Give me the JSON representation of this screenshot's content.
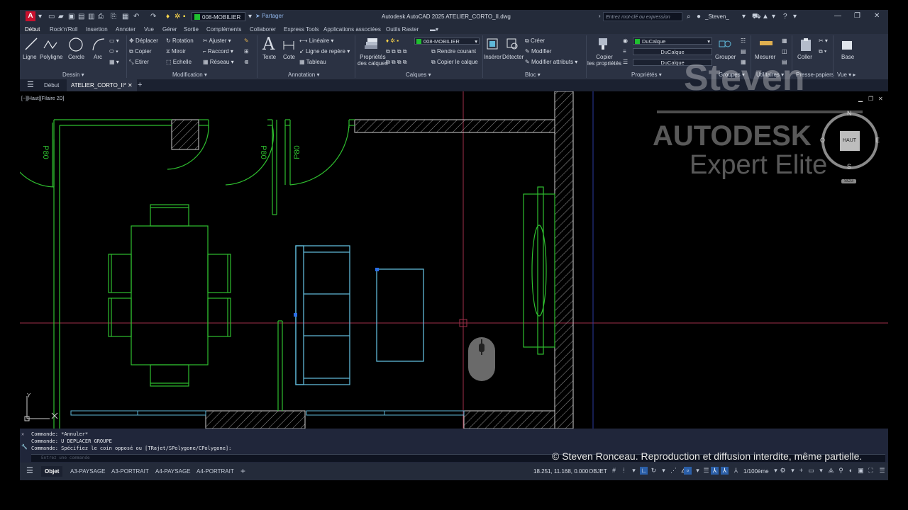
{
  "titlebar": {
    "app_title": "Autodesk AutoCAD 2025    ATELIER_CORTO_II.dwg",
    "layer": "008-MOBILIER",
    "share_label": "Partager",
    "search_placeholder": "Entrez mot-clé ou expression",
    "user": "_Steven_"
  },
  "ribbon_tabs": [
    "Début",
    "Rock'n'Roll",
    "Insertion",
    "Annoter",
    "Vue",
    "Gérer",
    "Sortie",
    "Compléments",
    "Collaborer",
    "Express Tools",
    "Applications associées",
    "Outils Raster"
  ],
  "ribbon": {
    "dessin": {
      "panel": "Dessin",
      "ligne": "Ligne",
      "polyligne": "Polyligne",
      "cercle": "Cercle",
      "arc": "Arc"
    },
    "modification": {
      "panel": "Modification",
      "deplacer": "Déplacer",
      "rotation": "Rotation",
      "ajuster": "Ajuster",
      "copier": "Copier",
      "miroir": "Miroir",
      "raccord": "Raccord",
      "etirer": "Etirer",
      "echelle": "Echelle",
      "reseau": "Réseau"
    },
    "annotation": {
      "panel": "Annotation",
      "texte": "Texte",
      "cote": "Cote",
      "lineaire": "Linéaire",
      "ligne_repere": "Ligne de repère",
      "tableau": "Tableau"
    },
    "calques": {
      "panel": "Calques",
      "proprietes1": "Propriétés",
      "proprietes2": "des calques",
      "layer": "008-MOBILIER",
      "rendre_courant": "Rendre courant",
      "copier_calque": "Copier le calque"
    },
    "bloc": {
      "panel": "Bloc",
      "inserer": "Insérer",
      "detecter": "Détecter",
      "creer": "Créer",
      "modifier": "Modifier",
      "modifier_attributs": "Modifier attributs"
    },
    "proprietes": {
      "panel": "Propriétés",
      "copier1": "Copier",
      "copier2": "les propriétés",
      "color": "DuCalque",
      "linetype": "DuCalque",
      "lineweight": "DuCalque"
    },
    "groupes": {
      "panel": "Groupes",
      "grouper": "Grouper"
    },
    "utilitaires": {
      "panel": "Utilitaires",
      "mesurer": "Mesurer"
    },
    "presse": {
      "panel": "Presse-papiers",
      "coller": "Coller"
    },
    "vue": {
      "panel": "Vue",
      "base": "Base"
    }
  },
  "doc_tabs": {
    "start": "Début",
    "current": "ATELIER_CORTO_II*"
  },
  "viewport": {
    "label": "[−][Haut][Filaire 2D]",
    "door_labels": [
      "P80",
      "P80",
      "P80"
    ],
    "viewcube": {
      "n": "N",
      "s": "S",
      "e": "E",
      "o": "O",
      "face": "HAUT",
      "wcs": "SCG"
    },
    "ucs_y": "Y",
    "ucs_x": "X"
  },
  "command": {
    "lines": [
      "Commande: *Annuler*",
      "Commande: U DEPLACER GROUPE",
      "Commande: Spécifiez le coin opposé ou [TRajet/SPolygone/CPolygone]:"
    ],
    "input_placeholder": "Entrez une commande"
  },
  "status": {
    "layout_tabs": [
      "Objet",
      "A3-PAYSAGE",
      "A3-PORTRAIT",
      "A4-PAYSAGE",
      "A4-PORTRAIT"
    ],
    "coords": "18.251, 11.168, 0.000",
    "mode": "OBJET",
    "scale": "1/100ème"
  },
  "watermark": {
    "name": "Steven",
    "brand": "AUTODESK",
    "sub": "Expert Elite"
  },
  "copyright": "© Steven Ronceau. Reproduction et diffusion interdite, même partielle.",
  "colors": {
    "green": "#2fbf2f",
    "cyan": "#5fb8d8",
    "red": "#c4304a",
    "accent": "#3b8beb"
  }
}
